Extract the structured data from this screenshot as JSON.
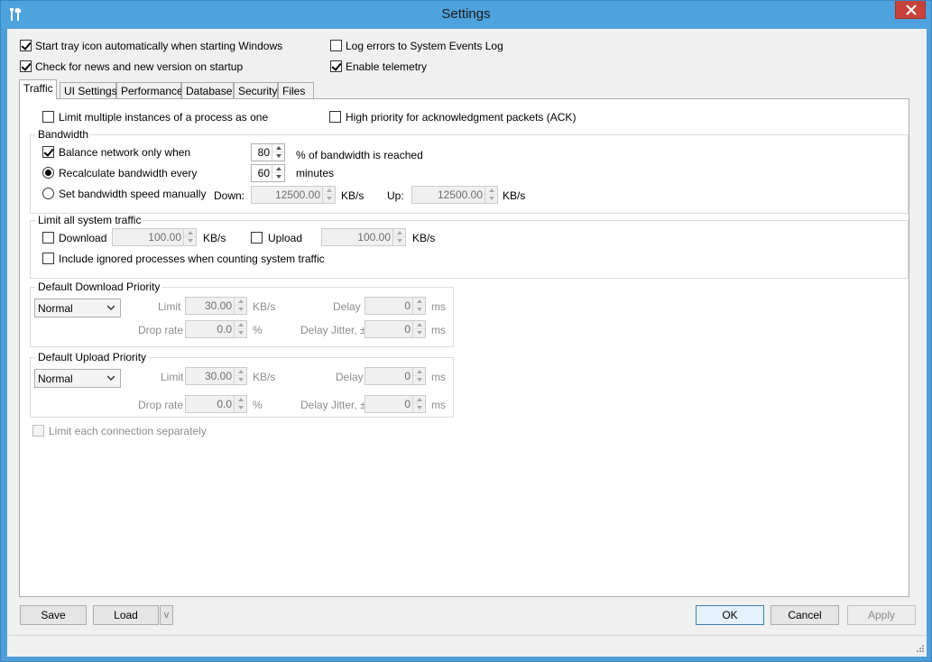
{
  "window": {
    "title": "Settings"
  },
  "top_options": {
    "start_tray": {
      "label": "Start tray icon automatically when starting Windows",
      "checked": true
    },
    "check_news": {
      "label": "Check for news and new version on startup",
      "checked": true
    },
    "log_errors": {
      "label": "Log errors to System Events Log",
      "checked": false
    },
    "telemetry": {
      "label": "Enable telemetry",
      "checked": true
    }
  },
  "tabs": [
    {
      "label": "Traffic",
      "active": true
    },
    {
      "label": "UI Settings",
      "active": false
    },
    {
      "label": "Performance",
      "active": false
    },
    {
      "label": "Database",
      "active": false
    },
    {
      "label": "Security",
      "active": false
    },
    {
      "label": "Files",
      "active": false
    }
  ],
  "traffic": {
    "limit_instances": {
      "label": "Limit multiple instances of a process as one",
      "checked": false
    },
    "high_priority_ack": {
      "label": "High priority for acknowledgment packets (ACK)",
      "checked": false
    },
    "bandwidth": {
      "title": "Bandwidth",
      "balance": {
        "label": "Balance network only when",
        "checked": true,
        "value": "80",
        "suffix": "% of bandwidth is reached"
      },
      "recalculate": {
        "label": "Recalculate bandwidth every",
        "selected": true,
        "value": "60",
        "suffix": "minutes"
      },
      "manual": {
        "label": "Set bandwidth speed manually",
        "selected": false,
        "down_label": "Down:",
        "down_value": "12500.00",
        "down_unit": "KB/s",
        "up_label": "Up:",
        "up_value": "12500.00",
        "up_unit": "KB/s"
      }
    },
    "system_traffic": {
      "title": "Limit all system traffic",
      "download": {
        "label": "Download",
        "checked": false,
        "value": "100.00",
        "unit": "KB/s"
      },
      "upload": {
        "label": "Upload",
        "checked": false,
        "value": "100.00",
        "unit": "KB/s"
      },
      "include_ignored": {
        "label": "Include ignored processes when counting system traffic",
        "checked": false
      }
    },
    "download_priority": {
      "title": "Default Download Priority",
      "selected": "Normal",
      "limit_label": "Limit",
      "limit_value": "30.00",
      "limit_unit": "KB/s",
      "delay_label": "Delay",
      "delay_value": "0",
      "delay_unit": "ms",
      "drop_label": "Drop rate",
      "drop_value": "0.0",
      "drop_unit": "%",
      "jitter_label": "Delay Jitter, ±",
      "jitter_value": "0",
      "jitter_unit": "ms"
    },
    "upload_priority": {
      "title": "Default Upload Priority",
      "selected": "Normal",
      "limit_label": "Limit",
      "limit_value": "30.00",
      "limit_unit": "KB/s",
      "delay_label": "Delay",
      "delay_value": "0",
      "delay_unit": "ms",
      "drop_label": "Drop rate",
      "drop_value": "0.0",
      "drop_unit": "%",
      "jitter_label": "Delay Jitter, ±",
      "jitter_value": "0",
      "jitter_unit": "ms"
    },
    "limit_each_connection": {
      "label": "Limit each connection separately",
      "checked": false,
      "disabled": true
    }
  },
  "buttons": {
    "save": "Save",
    "load": "Load",
    "load_more": "v",
    "ok": "OK",
    "cancel": "Cancel",
    "apply": "Apply"
  },
  "colors": {
    "titlebar": "#4ea2dd",
    "close": "#c7423a",
    "panel": "#ffffff",
    "dialog": "#f0f0f0"
  },
  "icons": {
    "app": "tools-icon",
    "close": "close-icon",
    "grip": "resize-grip-icon",
    "dropdown": "chevron-down-icon"
  }
}
